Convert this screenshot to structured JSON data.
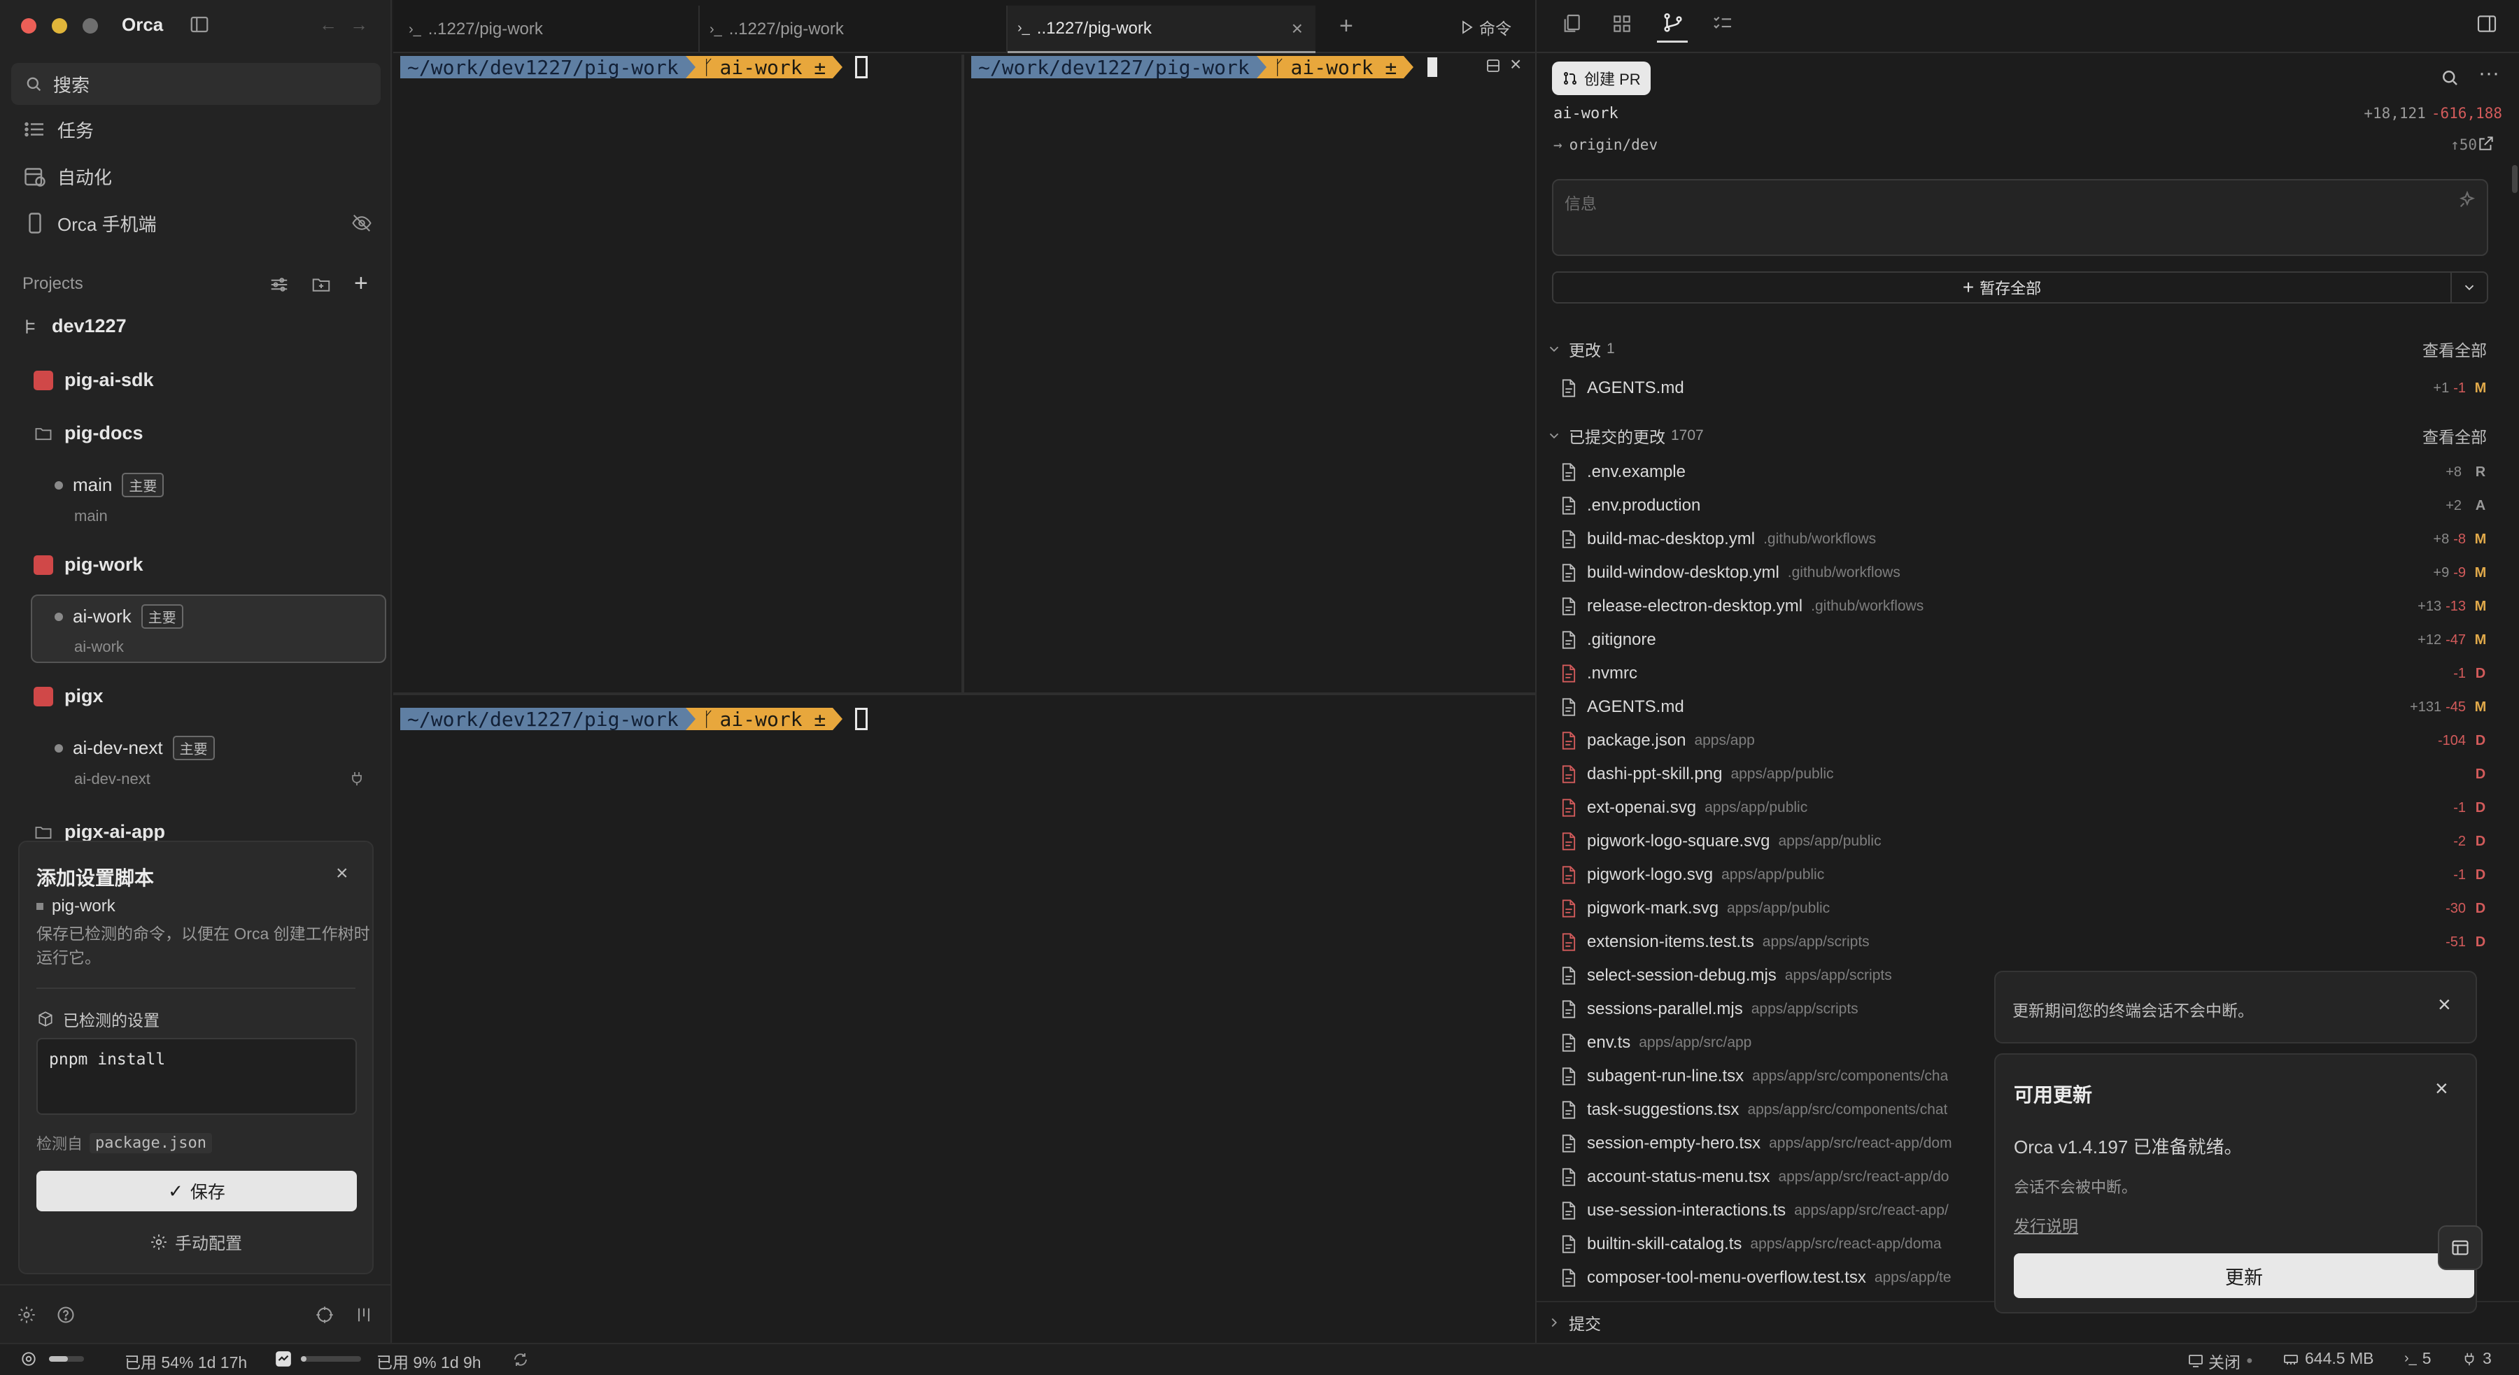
{
  "app": {
    "name": "Orca"
  },
  "sidebar": {
    "search_label": "搜索",
    "nav": [
      {
        "label": "任务",
        "icon": "list-icon"
      },
      {
        "label": "自动化",
        "icon": "calendar-clock-icon"
      },
      {
        "label": "Orca 手机端",
        "icon": "phone-icon"
      }
    ],
    "projects_header": "Projects",
    "group_name": "dev1227",
    "projects": [
      {
        "name": "pig-ai-sdk"
      },
      {
        "name": "pig-docs",
        "branches": [
          {
            "name": "main",
            "badge": "主要",
            "sub": "main"
          }
        ]
      },
      {
        "name": "pig-work",
        "branches": [
          {
            "name": "ai-work",
            "badge": "主要",
            "sub": "ai-work"
          }
        ]
      },
      {
        "name": "pigx",
        "branches": [
          {
            "name": "ai-dev-next",
            "badge": "主要",
            "sub": "ai-dev-next"
          }
        ]
      },
      {
        "name": "pigx-ai-app"
      }
    ],
    "setup_card": {
      "title": "添加设置脚本",
      "project": "pig-work",
      "description": "保存已检测的命令，以便在 Orca 创建工作树时运行它。",
      "detected_label": "已检测的设置",
      "command": "pnpm install",
      "detected_from_label": "检测自",
      "detected_from_file": "package.json",
      "save_label": "保存",
      "manual_label": "手动配置"
    }
  },
  "tabs": [
    {
      "label": "..1227/pig-work",
      "active": false
    },
    {
      "label": "..1227/pig-work",
      "active": false
    },
    {
      "label": "..1227/pig-work",
      "active": true
    }
  ],
  "toolbar": {
    "command_label": "命令"
  },
  "terminal": {
    "path": "~/work/dev1227/pig-work",
    "branch": "ai-work ±"
  },
  "right_panel": {
    "create_pr_label": "创建 PR",
    "branch": "ai-work",
    "additions": "+18,121",
    "deletions": "-616,188",
    "upstream": "origin/dev",
    "ahead": "↑50",
    "message_placeholder": "信息",
    "stash_all_label": "暂存全部",
    "changes_section": {
      "title": "更改",
      "count": "1",
      "view_all": "查看全部"
    },
    "changes": [
      {
        "name": "AGENTS.md",
        "path": "",
        "plus": "+1",
        "minus": "-1",
        "code": "M"
      }
    ],
    "committed_section": {
      "title": "已提交的更改",
      "count": "1707",
      "view_all": "查看全部"
    },
    "committed": [
      {
        "name": ".env.example",
        "path": "",
        "plus": "+8",
        "minus": "",
        "code": "R"
      },
      {
        "name": ".env.production",
        "path": "",
        "plus": "+2",
        "minus": "",
        "code": "A"
      },
      {
        "name": "build-mac-desktop.yml",
        "path": ".github/workflows",
        "plus": "+8",
        "minus": "-8",
        "code": "M"
      },
      {
        "name": "build-window-desktop.yml",
        "path": ".github/workflows",
        "plus": "+9",
        "minus": "-9",
        "code": "M"
      },
      {
        "name": "release-electron-desktop.yml",
        "path": ".github/workflows",
        "plus": "+13",
        "minus": "-13",
        "code": "M"
      },
      {
        "name": ".gitignore",
        "path": "",
        "plus": "+12",
        "minus": "-47",
        "code": "M"
      },
      {
        "name": ".nvmrc",
        "path": "",
        "plus": "",
        "minus": "-1",
        "code": "D"
      },
      {
        "name": "AGENTS.md",
        "path": "",
        "plus": "+131",
        "minus": "-45",
        "code": "M"
      },
      {
        "name": "package.json",
        "path": "apps/app",
        "plus": "",
        "minus": "-104",
        "code": "D"
      },
      {
        "name": "dashi-ppt-skill.png",
        "path": "apps/app/public",
        "plus": "",
        "minus": "",
        "code": "D"
      },
      {
        "name": "ext-openai.svg",
        "path": "apps/app/public",
        "plus": "",
        "minus": "-1",
        "code": "D"
      },
      {
        "name": "pigwork-logo-square.svg",
        "path": "apps/app/public",
        "plus": "",
        "minus": "-2",
        "code": "D"
      },
      {
        "name": "pigwork-logo.svg",
        "path": "apps/app/public",
        "plus": "",
        "minus": "-1",
        "code": "D"
      },
      {
        "name": "pigwork-mark.svg",
        "path": "apps/app/public",
        "plus": "",
        "minus": "-30",
        "code": "D"
      },
      {
        "name": "extension-items.test.ts",
        "path": "apps/app/scripts",
        "plus": "",
        "minus": "-51",
        "code": "D"
      },
      {
        "name": "select-session-debug.mjs",
        "path": "apps/app/scripts",
        "plus": "",
        "minus": "",
        "code": ""
      },
      {
        "name": "sessions-parallel.mjs",
        "path": "apps/app/scripts",
        "plus": "",
        "minus": "",
        "code": ""
      },
      {
        "name": "env.ts",
        "path": "apps/app/src/app",
        "plus": "",
        "minus": "",
        "code": ""
      },
      {
        "name": "subagent-run-line.tsx",
        "path": "apps/app/src/components/cha",
        "plus": "",
        "minus": "",
        "code": ""
      },
      {
        "name": "task-suggestions.tsx",
        "path": "apps/app/src/components/chat",
        "plus": "",
        "minus": "",
        "code": ""
      },
      {
        "name": "session-empty-hero.tsx",
        "path": "apps/app/src/react-app/dom",
        "plus": "",
        "minus": "",
        "code": ""
      },
      {
        "name": "account-status-menu.tsx",
        "path": "apps/app/src/react-app/do",
        "plus": "",
        "minus": "",
        "code": ""
      },
      {
        "name": "use-session-interactions.ts",
        "path": "apps/app/src/react-app/",
        "plus": "",
        "minus": "",
        "code": ""
      },
      {
        "name": "builtin-skill-catalog.ts",
        "path": "apps/app/src/react-app/doma",
        "plus": "",
        "minus": "",
        "code": ""
      },
      {
        "name": "composer-tool-menu-overflow.test.tsx",
        "path": "apps/app/te",
        "plus": "",
        "minus": "",
        "code": ""
      }
    ],
    "commit_section": "提交"
  },
  "toasts": {
    "terminal_notice": "更新期间您的终端会话不会中断。",
    "update_title": "可用更新",
    "update_message": "Orca v1.4.197 已准备就绪。",
    "update_sub": "会话不会被中断。",
    "release_notes": "发行说明",
    "update_button": "更新"
  },
  "status_bar": {
    "usage1": "已用 54% 1d 17h",
    "usage1_fraction": 0.54,
    "usage2": "已用 9% 1d 9h",
    "usage2_fraction": 0.09,
    "port_label": "关闭",
    "memory": "644.5 MB",
    "terminals": "5",
    "ports": "3"
  },
  "colors": {
    "accent_blue": "#5f7fa3",
    "accent_yellow": "#e8a73c",
    "modified": "#e0a94a",
    "deleted": "#d35b5b"
  }
}
